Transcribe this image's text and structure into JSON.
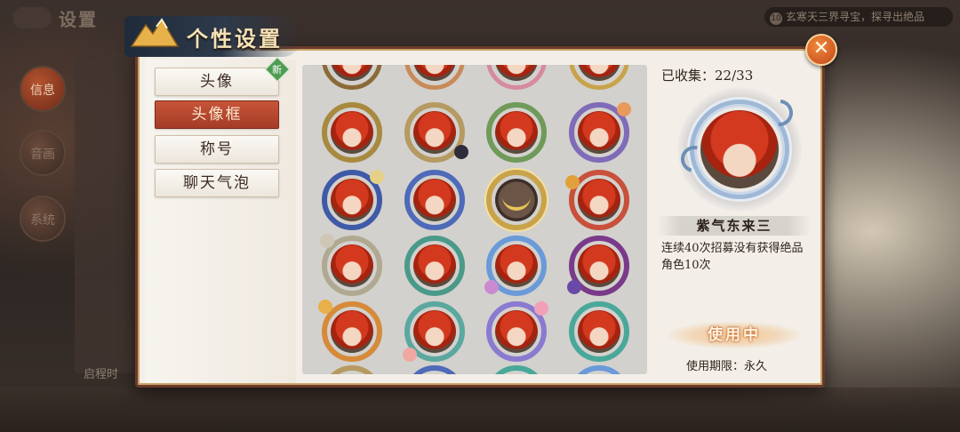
{
  "background": {
    "title": "设置",
    "ticker": "玄寒天三界寻宝，探寻出绝品",
    "ticker_icon": "10",
    "side_buttons": [
      "信息",
      "音画",
      "系统"
    ],
    "bottom_text": "启程时"
  },
  "dialog": {
    "title": "个性设置",
    "close_icon": "close-icon"
  },
  "tabs": [
    {
      "label": "头像",
      "badge": "新",
      "active": false
    },
    {
      "label": "头像框",
      "active": true
    },
    {
      "label": "称号",
      "active": false
    },
    {
      "label": "聊天气泡",
      "active": false
    }
  ],
  "collection": {
    "label": "已收集：",
    "count": "22/33"
  },
  "selected_frame": {
    "name": "紫气东来三",
    "description": "连续40次招募没有获得绝品角色10次",
    "status": "使用中",
    "validity": "使用期限：永久"
  },
  "colors": {
    "accent_red": "#b4452d",
    "dialog_border": "#6b3a2a",
    "badge_green": "#4f9d55",
    "title_gold": "#f6e2b5"
  }
}
